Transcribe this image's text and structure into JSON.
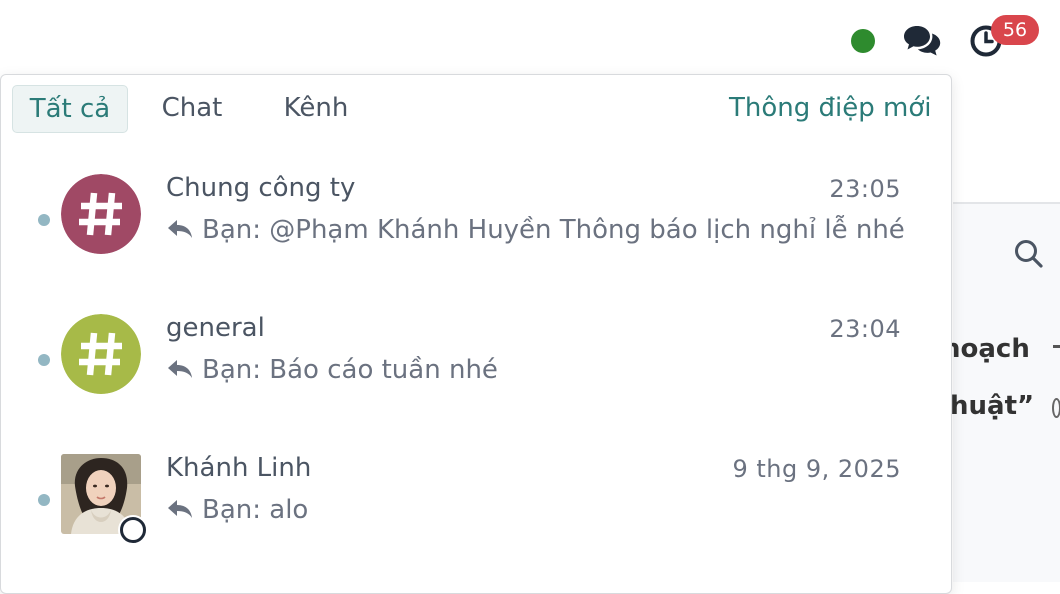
{
  "topbar": {
    "presence_color": "#2e8b2e",
    "chat_icon": "chat-bubbles-icon",
    "activity_icon": "clock-icon",
    "activity_badge": "56"
  },
  "background": {
    "search_icon": "search-icon",
    "text1": "hoạch",
    "text2": "huật”"
  },
  "messaging": {
    "tabs": [
      {
        "label": "Tất cả",
        "active": true
      },
      {
        "label": "Chat",
        "active": false
      },
      {
        "label": "Kênh",
        "active": false
      }
    ],
    "new_message_label": "Thông điệp mới",
    "threads": [
      {
        "name": "Chung công ty",
        "time": "23:05",
        "preview": "Bạn: @Phạm Khánh Huyền Thông báo lịch nghỉ lễ nhé",
        "avatar": "hash-channel-icon",
        "avatar_color": "#a04965",
        "unread": true
      },
      {
        "name": "general",
        "time": "23:04",
        "preview": "Bạn: Báo cáo tuần nhé",
        "avatar": "hash-channel-icon",
        "avatar_color": "#a7ba48",
        "unread": true
      },
      {
        "name": "Khánh Linh",
        "time": "9 thg 9, 2025",
        "preview": "Bạn: alo",
        "avatar": "user-photo",
        "status": "offline",
        "unread": true
      }
    ]
  }
}
